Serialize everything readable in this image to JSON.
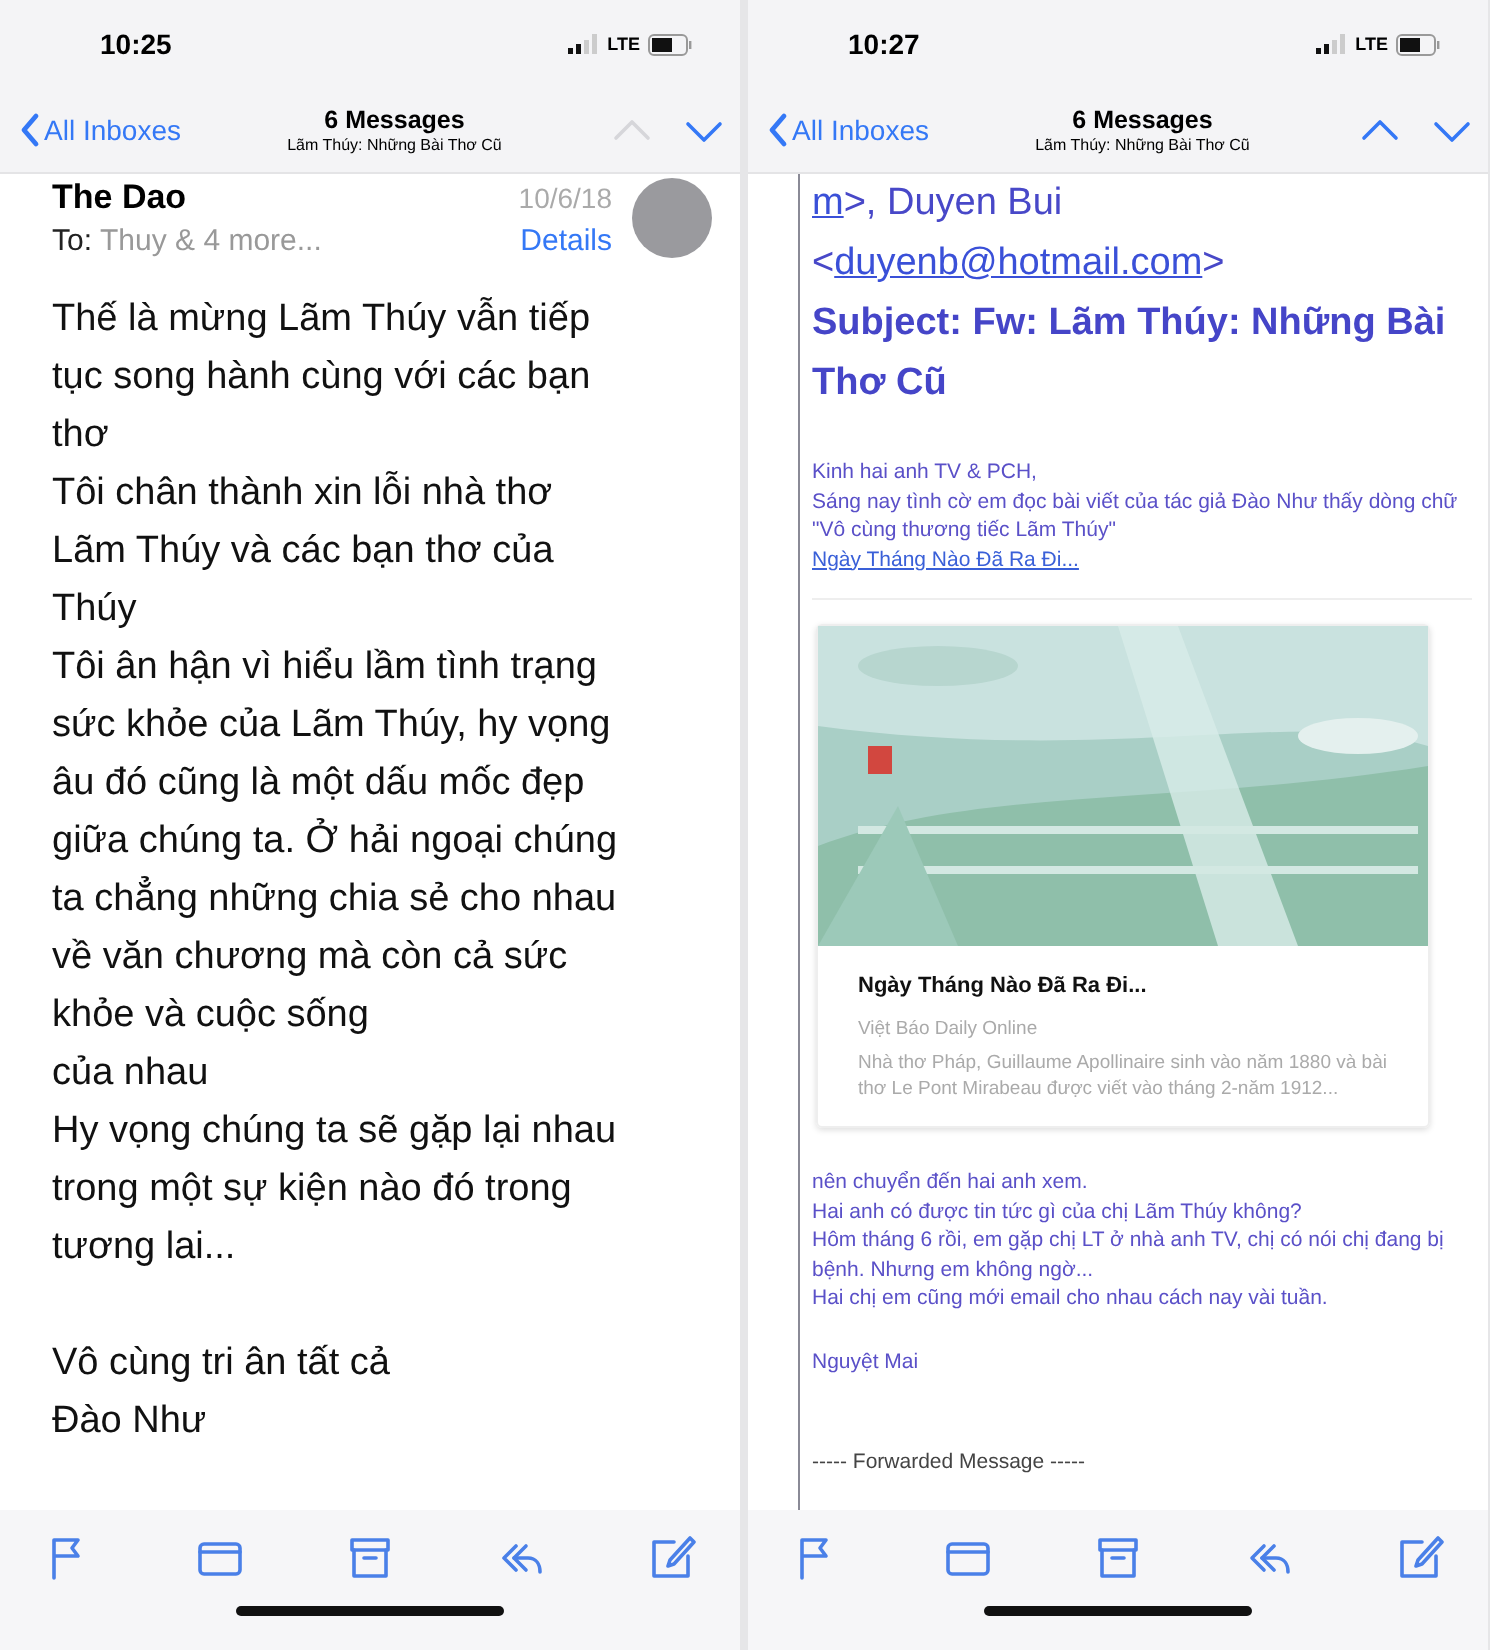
{
  "screens": [
    {
      "status_bar": {
        "time": "10:25",
        "network": "LTE"
      },
      "nav": {
        "back": "All Inboxes",
        "title": "6 Messages",
        "subtitle": "Lãm Thúy: Những Bài Thơ Cũ",
        "arrows": [
          {
            "kind": "up",
            "disabled": true
          },
          {
            "kind": "down",
            "disabled": false
          }
        ]
      },
      "content": {
        "kind": "message",
        "sender": "The Dao",
        "date": "10/6/18",
        "to_label": "To:",
        "to": "Thuy & 4 more...",
        "details": "Details",
        "paragraphs": [
          "Thế là mừng Lãm Thúy vẫn tiếp\ntục song hành cùng với các bạn\nthơ\nTôi chân thành xin lỗi nhà thơ\nLãm Thúy và các bạn thơ của\nThúy\nTôi ân hận vì hiểu lầm tình trạng\nsức khỏe của Lãm Thúy, hy vọng\nâu đó cũng là một dấu mốc đẹp\ngiữa chúng ta. Ở hải ngoại chúng\nta chẳng những chia sẻ cho nhau\nvề văn chương mà còn cả sức\nkhỏe và cuộc sống\ncủa nhau\nHy vọng chúng ta sẽ gặp lại nhau\ntrong một sự kiện nào đó trong\ntương lai...",
          "Vô cùng tri ân tất cả\nĐào Như"
        ]
      }
    },
    {
      "status_bar": {
        "time": "10:27",
        "network": "LTE"
      },
      "nav": {
        "back": "All Inboxes",
        "title": "6 Messages",
        "subtitle": "Lãm Thúy: Những Bài Thơ Cũ",
        "arrows": [
          {
            "kind": "up",
            "disabled": false
          },
          {
            "kind": "down",
            "disabled": false
          }
        ]
      },
      "content": {
        "kind": "forward",
        "blocks": [
          {
            "kind": "address",
            "segments": [
              {
                "text": "m",
                "link": true
              },
              {
                "text": ">, Duyen Bui",
                "link": false
              }
            ]
          },
          {
            "kind": "address",
            "segments": [
              {
                "text": "<",
                "link": false
              },
              {
                "text": "duyenb@hotmail.com",
                "link": true
              },
              {
                "text": ">",
                "link": false
              }
            ]
          },
          {
            "kind": "subject",
            "text": "Subject: Fw: Lãm Thúy: Những Bài Thơ Cũ"
          },
          {
            "kind": "text",
            "text": "Kinh hai anh TV & PCH,\nSáng nay tình cờ em đọc bài viết của tác giả Đào Như thấy dòng chữ \"Vô cùng thương tiếc Lãm Thúy\""
          },
          {
            "kind": "link",
            "text": "Ngày Tháng Nào Đã Ra Đi..."
          },
          {
            "kind": "card",
            "title": "Ngày Tháng Nào Đã Ra Đi...",
            "source": "Việt Báo Daily Online",
            "description": "Nhà thơ Pháp, Guillaume Apollinaire sinh vào năm 1880 và bài thơ Le Pont Mirabeau được viết vào tháng 2-năm 1912..."
          },
          {
            "kind": "text",
            "text": "nên chuyển đến hai anh xem.\nHai anh có được tin tức gì của chị Lãm Thúy không?\nHôm tháng 6 rồi, em gặp chị LT ở nhà anh TV, chị có nói chị đang bị bệnh. Nhưng em không ngờ...\nHai chị em cũng mới email cho nhau cách nay vài tuần."
          },
          {
            "kind": "signature",
            "text": "Nguyệt Mai"
          },
          {
            "kind": "separator",
            "text": "----- Forwarded Message -----"
          }
        ]
      }
    }
  ]
}
